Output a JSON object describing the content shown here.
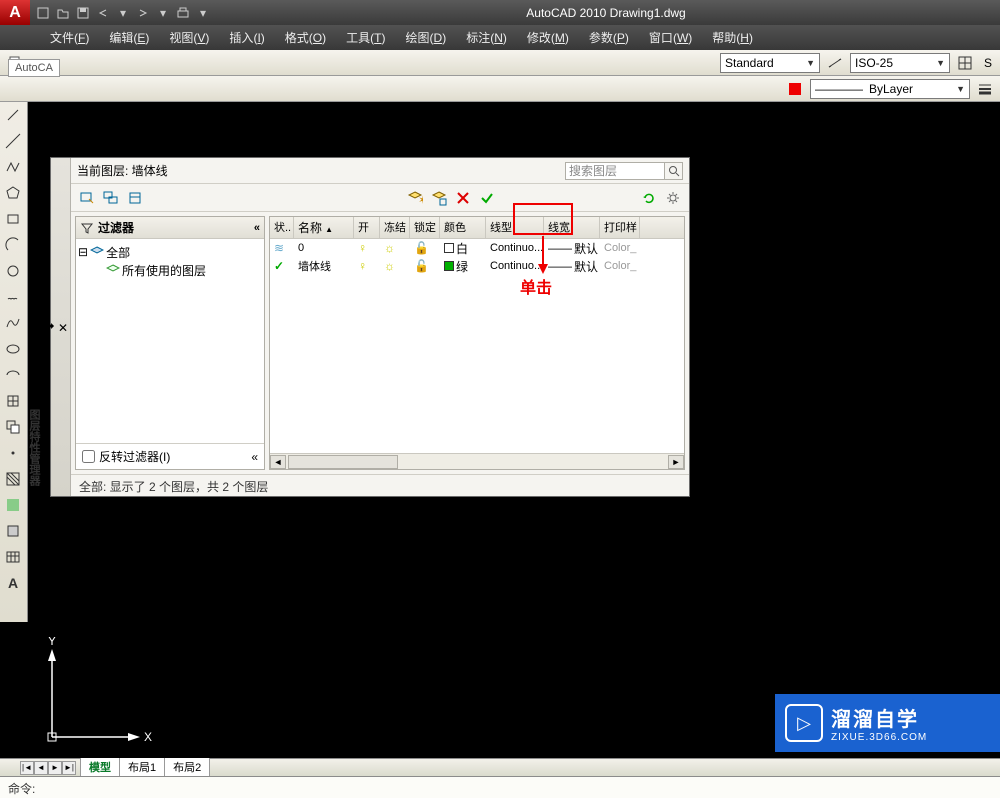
{
  "title": {
    "app": "AutoCAD 2010",
    "gap": "   ",
    "file": "Drawing1.dwg"
  },
  "menu": [
    {
      "label": "文件",
      "key": "F"
    },
    {
      "label": "编辑",
      "key": "E"
    },
    {
      "label": "视图",
      "key": "V"
    },
    {
      "label": "插入",
      "key": "I"
    },
    {
      "label": "格式",
      "key": "O"
    },
    {
      "label": "工具",
      "key": "T"
    },
    {
      "label": "绘图",
      "key": "D"
    },
    {
      "label": "标注",
      "key": "N"
    },
    {
      "label": "修改",
      "key": "M"
    },
    {
      "label": "参数",
      "key": "P"
    },
    {
      "label": "窗口",
      "key": "W"
    },
    {
      "label": "帮助",
      "key": "H"
    }
  ],
  "toolbar_right": {
    "style_combo": "Standard",
    "dim_combo": "ISO-25",
    "s_label": "S",
    "bylayer": "ByLayer"
  },
  "autoca_tab": "AutoCA",
  "layer_dialog": {
    "header_prefix": "当前图层: ",
    "header_layer": "墙体线",
    "search_placeholder": "搜索图层",
    "filter_header": "过滤器",
    "collapse_sym": "«",
    "tree_root": "全部",
    "tree_child": "所有使用的图层",
    "invert_filter": "反转过滤器(I)",
    "columns": {
      "status": "状..",
      "name": "名称",
      "on": "开",
      "freeze": "冻结",
      "lock": "锁定",
      "color": "颜色",
      "linetype": "线型",
      "lineweight": "线宽",
      "plotstyle": "打印样"
    },
    "rows": [
      {
        "status": "≋",
        "name": "0",
        "on": "💡",
        "freeze": "☀",
        "lock": "🔓",
        "color_swatch": "#ffffff",
        "color": "白",
        "linetype": "Continuo...",
        "lweight_sym": "——",
        "lineweight": "默认",
        "plotstyle": "Color_"
      },
      {
        "status": "✓",
        "name": "墙体线",
        "on": "💡",
        "freeze": "☀",
        "lock": "🔓",
        "color_swatch": "#00b000",
        "color": "绿",
        "linetype": "Continuo...",
        "lweight_sym": "——",
        "lineweight": "默认",
        "plotstyle": "Color_"
      }
    ],
    "status_bar": "全部: 显示了 2 个图层，共 2 个图层"
  },
  "annotation": {
    "label": "单击"
  },
  "ucs": {
    "y": "Y",
    "x": "X"
  },
  "model_tabs": {
    "model": "模型",
    "layout1": "布局1",
    "layout2": "布局2"
  },
  "command_line": "命令:",
  "watermark": {
    "big": "溜溜自学",
    "small": "ZIXUE.3D66.COM",
    "logo": "▷"
  }
}
